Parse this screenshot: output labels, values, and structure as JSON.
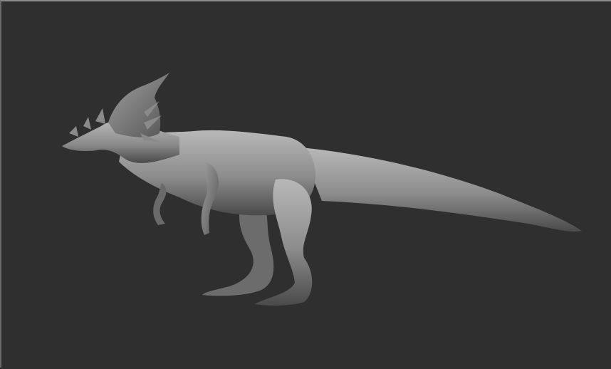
{
  "viewport": {
    "subject": "dinosaur-sculpt",
    "colors": {
      "background": "#2f2f2f",
      "frame": "#8a8a8a",
      "model_light": "#b8b8b8",
      "model_mid": "#8c8c8c",
      "model_dark": "#4a4a4a"
    }
  }
}
